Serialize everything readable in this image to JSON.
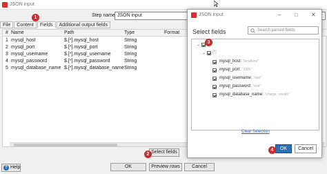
{
  "main_window": {
    "title": "JSON input",
    "stepname_label": "Step name",
    "stepname_value": "JSON input",
    "tabs": [
      "File",
      "Content",
      "Fields",
      "Additional output fields"
    ],
    "active_tab": "Fields",
    "columns": [
      "#",
      "Name",
      "Path",
      "Type",
      "Format"
    ],
    "rows": [
      {
        "num": "1",
        "name": "mysql_host",
        "path": "$.[*].mysql_host",
        "type": "String"
      },
      {
        "num": "2",
        "name": "mysql_port",
        "path": "$.[*].mysql_port",
        "type": "String"
      },
      {
        "num": "3",
        "name": "mysql_username",
        "path": "$.[*].mysql_username",
        "type": "String"
      },
      {
        "num": "4",
        "name": "mysql_password",
        "path": "$.[*].mysql_password",
        "type": "String"
      },
      {
        "num": "5",
        "name": "mysql_database_name",
        "path": "$.[*].mysql_database_name",
        "type": "String"
      }
    ],
    "select_fields_button": "Select fields",
    "help_button": "Help",
    "ok_button": "OK",
    "preview_button": "Preview rows",
    "cancel_button": "Cancel"
  },
  "dialog": {
    "title": "JSON input",
    "heading": "Select fields",
    "search_placeholder": "Search parsed fields",
    "tree_root": "$",
    "tree_array": "[*]",
    "fields": [
      {
        "name": "mysql_host:",
        "value": "\"localhost\""
      },
      {
        "name": "mysql_port:",
        "value": "\"3306\""
      },
      {
        "name": "mysql_username:",
        "value": "\"root\""
      },
      {
        "name": "mysql_password:",
        "value": "\"root\""
      },
      {
        "name": "mysql_database_name:",
        "value": "\"sharpe_results\""
      }
    ],
    "clear_selection": "Clear Selection",
    "ok_label": "OK",
    "cancel_label": "Cancel"
  },
  "badges": [
    "1",
    "2",
    "3",
    "4"
  ],
  "colors": {
    "accent": "#2b6fb6",
    "badge": "#c72d2d",
    "app_icon": "#d6312f"
  }
}
